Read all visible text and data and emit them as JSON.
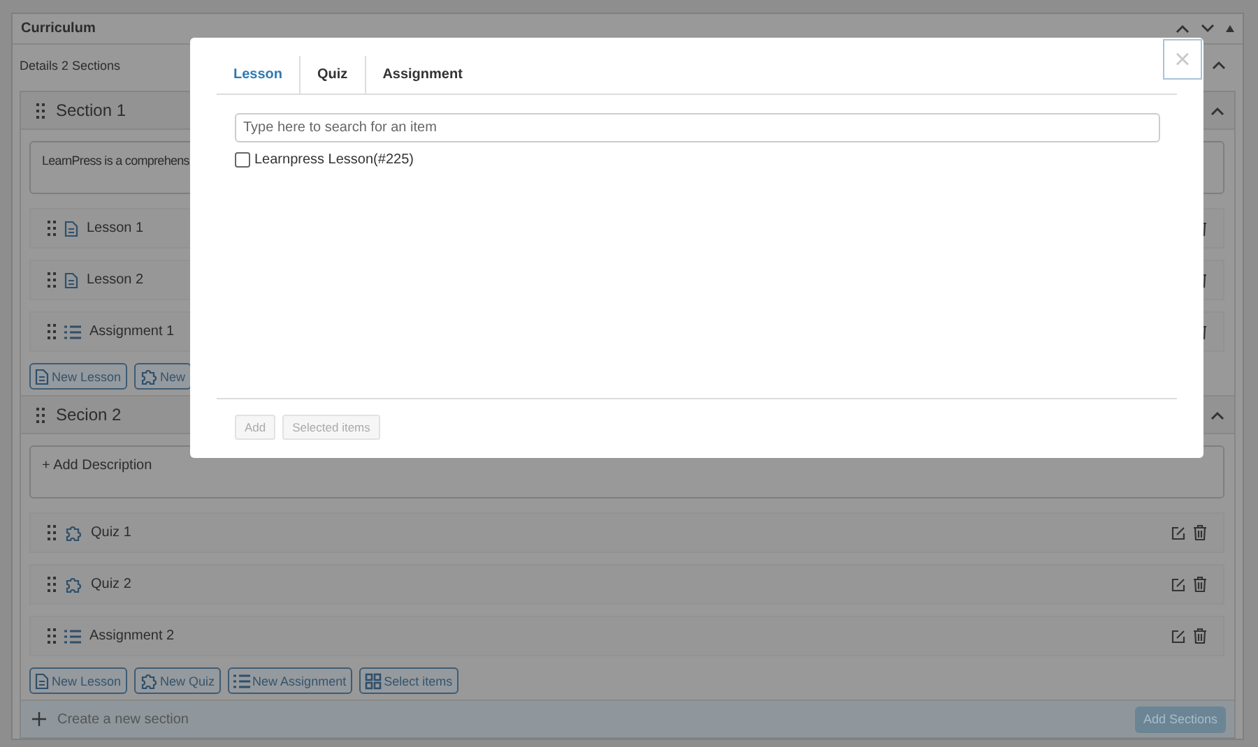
{
  "panel": {
    "title": "Curriculum",
    "summary": "Details 2 Sections"
  },
  "sections": [
    {
      "title": "Section 1",
      "description": {
        "text": "LearnPress is a comprehens"
      },
      "items": [
        {
          "kind": "lesson",
          "title": "Lesson 1"
        },
        {
          "kind": "lesson",
          "title": "Lesson 2"
        },
        {
          "kind": "assignment",
          "title": "Assignment 1"
        }
      ],
      "buttons": [
        {
          "kind": "lesson",
          "label": "New Lesson"
        },
        {
          "kind": "quiz",
          "label": "New"
        }
      ]
    },
    {
      "title": "Secion 2",
      "description": {
        "placeholder": "+ Add Description"
      },
      "items": [
        {
          "kind": "quiz",
          "title": "Quiz 1"
        },
        {
          "kind": "quiz",
          "title": "Quiz 2"
        },
        {
          "kind": "assignment",
          "title": "Assignment 2"
        }
      ],
      "buttons": [
        {
          "kind": "lesson",
          "label": "New Lesson"
        },
        {
          "kind": "quiz",
          "label": "New Quiz"
        },
        {
          "kind": "assignment",
          "label": "New Assignment"
        },
        {
          "kind": "select",
          "label": "Select items"
        }
      ]
    }
  ],
  "new_section": {
    "placeholder": "Create a new section"
  },
  "add_button": "Add Sections",
  "modal": {
    "close": "×",
    "tabs": [
      {
        "label": "Lesson",
        "selected": true
      },
      {
        "label": "Quiz",
        "selected": false
      },
      {
        "label": "Assignment",
        "selected": false
      }
    ],
    "search": {
      "placeholder": "Type here to search for an item"
    },
    "results": [
      {
        "label": "Learnpress Lesson(#225)",
        "checked": false
      }
    ],
    "buttons": [
      {
        "label": "Add",
        "disabled": true
      },
      {
        "label": "Selected items",
        "disabled": true
      }
    ]
  }
}
